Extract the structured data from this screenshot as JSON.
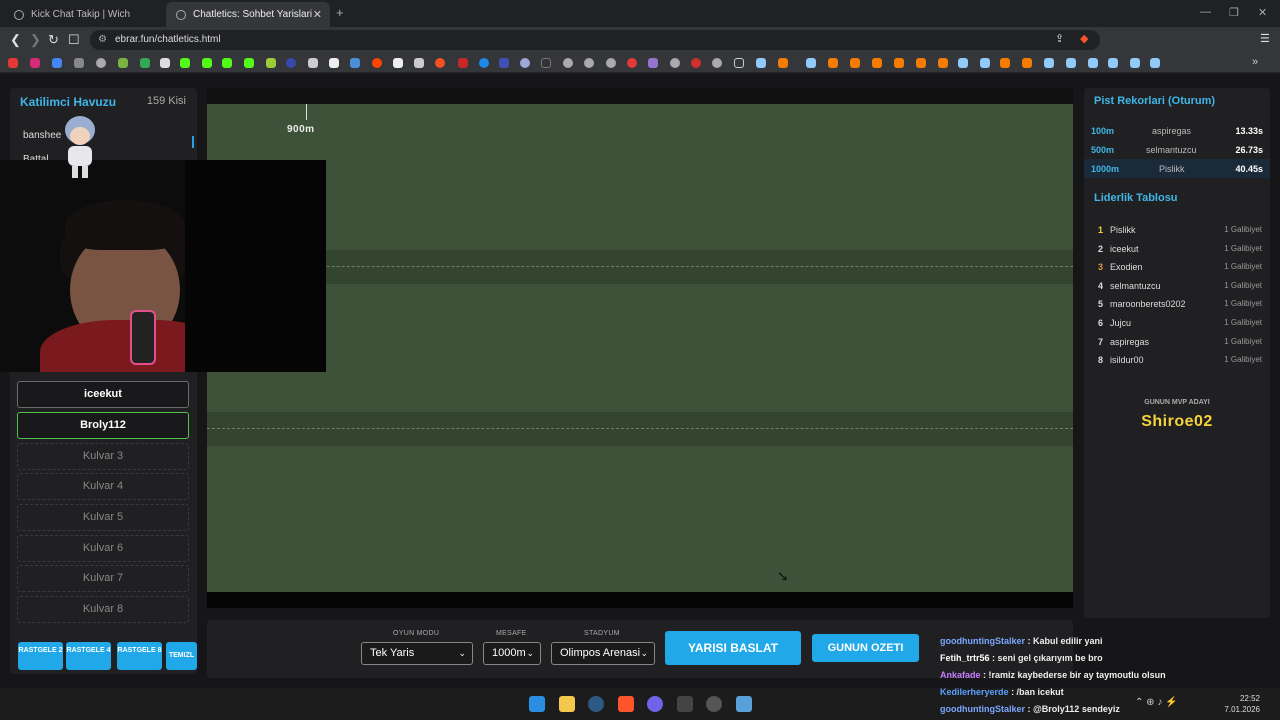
{
  "browser": {
    "tabs": [
      {
        "title": "Kick Chat Takip | Wich"
      },
      {
        "title": "Chatletics: Sohbet Yarislari"
      }
    ],
    "url": "ebrar.fun/chatletics.html"
  },
  "left_panel": {
    "title": "Katilimci Havuzu",
    "count": "159 Kisi",
    "pool_items": [
      "banshee",
      "Battal"
    ],
    "lanes": [
      "iceekut",
      "Broly112",
      "Kulvar 3",
      "Kulvar 4",
      "Kulvar 5",
      "Kulvar 6",
      "Kulvar 7",
      "Kulvar 8"
    ],
    "random_buttons": [
      "RASTGELE 2",
      "RASTGELE 4",
      "RASTGELE 8",
      "TEMIZL"
    ]
  },
  "track": {
    "distance_marker": "900m"
  },
  "controls": {
    "mode_label": "OYUN MODU",
    "mode_value": "Tek Yaris",
    "distance_label": "MESAFE",
    "distance_value": "1000m",
    "stadium_label": "STADYUM",
    "stadium_value": "Olimpos Arenasi",
    "start_label": "YARISI BASLAT",
    "summary_label": "GUNUN OZETI"
  },
  "records": {
    "title": "Pist Rekorlari (Oturum)",
    "rows": [
      {
        "distance": "100m",
        "name": "aspiregas",
        "time": "13.33s"
      },
      {
        "distance": "500m",
        "name": "selmantuzcu",
        "time": "26.73s"
      },
      {
        "distance": "1000m",
        "name": "Pislikk",
        "time": "40.45s"
      }
    ]
  },
  "leaderboard": {
    "title": "Liderlik Tablosu",
    "rows": [
      {
        "rank": "1",
        "name": "Pislikk",
        "wins": "1 Galibiyet"
      },
      {
        "rank": "2",
        "name": "iceekut",
        "wins": "1 Galibiyet"
      },
      {
        "rank": "3",
        "name": "Exodien",
        "wins": "1 Galibiyet"
      },
      {
        "rank": "4",
        "name": "selmantuzcu",
        "wins": "1 Galibiyet"
      },
      {
        "rank": "5",
        "name": "maroonberets0202",
        "wins": "1 Galibiyet"
      },
      {
        "rank": "6",
        "name": "Jujcu",
        "wins": "1 Galibiyet"
      },
      {
        "rank": "7",
        "name": "aspiregas",
        "wins": "1 Galibiyet"
      },
      {
        "rank": "8",
        "name": "isildur00",
        "wins": "1 Galibiyet"
      }
    ],
    "rank_colors": [
      "#f5d23a",
      "#dddddd",
      "#e8923a",
      "#dddddd",
      "#dddddd",
      "#dddddd",
      "#dddddd",
      "#dddddd"
    ]
  },
  "mvp": {
    "label": "GUNUN MVP ADAYI",
    "name": "Shiroe02"
  },
  "chat": {
    "messages": [
      {
        "user": "goodhuntingStalker",
        "text": ": Kabul edilir yani",
        "color": "#7aa7ff"
      },
      {
        "user": "Fetih_trtr56",
        "text": ": seni gel çıkarıyım be bro",
        "color": "#ffffff"
      },
      {
        "user": "Ankafade",
        "text": ": !ramiz kaybederse bir ay taymoutlu olsun",
        "color": "#c77dff"
      },
      {
        "user": "Kedilerheryerde",
        "text": ": /ban icekut",
        "color": "#5aa0ff"
      },
      {
        "user": "goodhuntingStalker",
        "text": ": @Broly112 sendeyiz",
        "color": "#7aa7ff"
      }
    ]
  },
  "clock": {
    "time": "22:52",
    "date": "7.01.2026"
  },
  "colors": {
    "accent": "#20a8e8",
    "title_blue": "#3fb6e8",
    "track_green": "#3d5238",
    "mvp_gold": "#f5d23a"
  }
}
